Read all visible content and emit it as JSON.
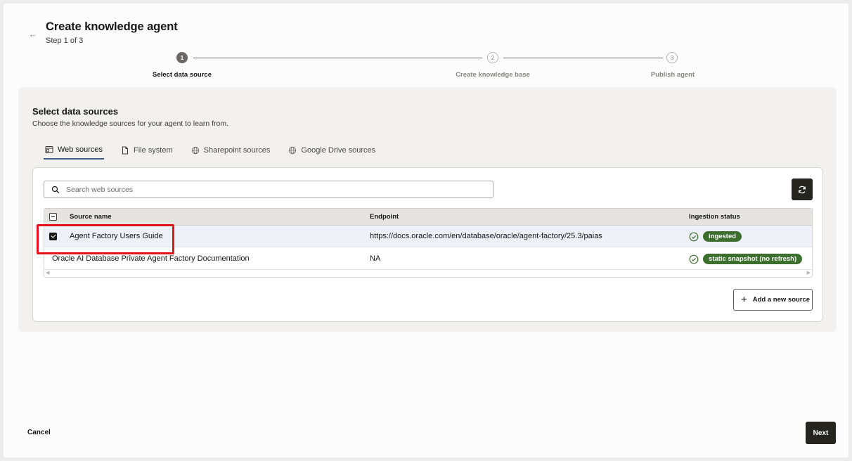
{
  "header": {
    "back_icon": "arrow-left-icon",
    "title": "Create knowledge agent",
    "subtitle": "Step 1 of 3"
  },
  "stepper": {
    "steps": [
      {
        "number": "1",
        "label": "Select data source",
        "state": "active"
      },
      {
        "number": "2",
        "label": "Create knowledge base",
        "state": "pending"
      },
      {
        "number": "3",
        "label": "Publish agent",
        "state": "pending"
      }
    ]
  },
  "panel": {
    "title": "Select data sources",
    "description": "Choose the knowledge sources for your agent to learn from."
  },
  "tabs": [
    {
      "label": "Web sources",
      "icon": "browser-icon",
      "active": true
    },
    {
      "label": "File system",
      "icon": "file-icon",
      "active": false
    },
    {
      "label": "Sharepoint sources",
      "icon": "globe-icon",
      "active": false
    },
    {
      "label": "Google Drive sources",
      "icon": "globe-icon",
      "active": false
    }
  ],
  "search": {
    "placeholder": "Search web sources"
  },
  "table": {
    "columns": [
      "Source name",
      "Endpoint",
      "Ingestion status"
    ],
    "header_checkbox": "mixed",
    "rows": [
      {
        "selected": true,
        "name": "Agent Factory Users Guide",
        "endpoint": "https://docs.oracle.com/en/database/oracle/agent-factory/25.3/paias",
        "status": "ingested"
      },
      {
        "selected": false,
        "name": "Oracle AI Database Private Agent Factory Documentation",
        "endpoint": "NA",
        "status": "static snapshot (no refresh)"
      }
    ]
  },
  "actions": {
    "add_source": "Add a new source",
    "cancel": "Cancel",
    "next": "Next"
  },
  "colors": {
    "accent": "#3e5d84",
    "badge_green": "#3c6e2e",
    "primary_button": "#26241f",
    "highlight": "#e5121b"
  }
}
